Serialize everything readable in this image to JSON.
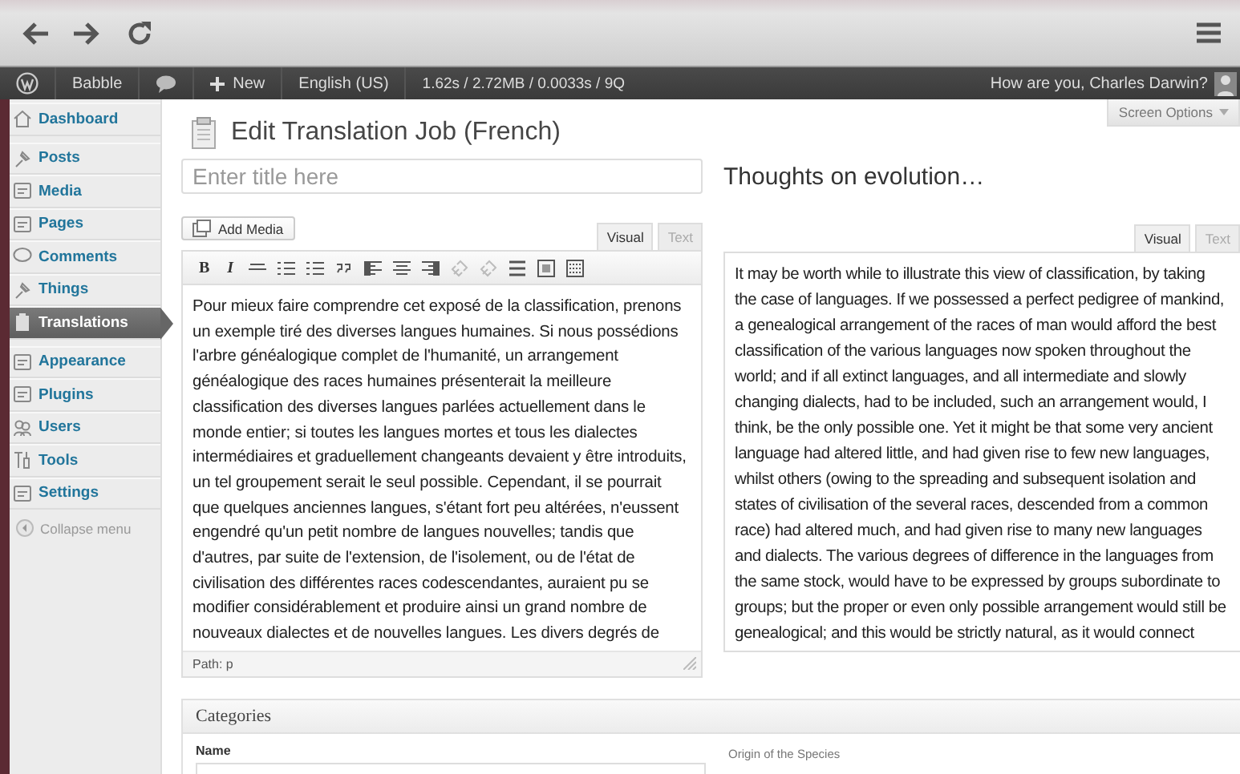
{
  "admin_bar": {
    "site": "Babble",
    "new": "New",
    "language": "English (US)",
    "stats": "1.62s / 2.72MB / 0.0033s / 9Q",
    "greeting": "How are you, Charles Darwin?"
  },
  "sidebar": {
    "items": [
      {
        "label": "Dashboard",
        "selected": false
      },
      {
        "label": "Posts",
        "selected": false
      },
      {
        "label": "Media",
        "selected": false
      },
      {
        "label": "Pages",
        "selected": false
      },
      {
        "label": "Comments",
        "selected": false
      },
      {
        "label": "Things",
        "selected": false
      },
      {
        "label": "Translations",
        "selected": true
      },
      {
        "label": "Appearance",
        "selected": false
      },
      {
        "label": "Plugins",
        "selected": false
      },
      {
        "label": "Users",
        "selected": false
      },
      {
        "label": "Tools",
        "selected": false
      },
      {
        "label": "Settings",
        "selected": false
      }
    ],
    "collapse": "Collapse menu"
  },
  "screen_options": "Screen Options",
  "page_title": "Edit Translation Job (French)",
  "title_field": {
    "placeholder": "Enter title here"
  },
  "original_title": "Thoughts on evolution…",
  "add_media": "Add Media",
  "translation_editor": {
    "tabs": [
      {
        "label": "Visual",
        "selected": true
      },
      {
        "label": "Text",
        "selected": false
      }
    ],
    "toolbar": [
      {
        "kind": "text",
        "label": "B",
        "disabled": false
      },
      {
        "kind": "text",
        "label": "I",
        "disabled": false
      },
      {
        "kind": "strike",
        "disabled": false
      },
      {
        "kind": "bullets",
        "disabled": false
      },
      {
        "kind": "numbers",
        "disabled": false
      },
      {
        "kind": "quote",
        "disabled": false
      },
      {
        "kind": "align-left",
        "disabled": false
      },
      {
        "kind": "align-center",
        "disabled": false
      },
      {
        "kind": "align-right",
        "disabled": false
      },
      {
        "kind": "link",
        "disabled": true
      },
      {
        "kind": "unlink",
        "disabled": true
      },
      {
        "kind": "more",
        "disabled": false
      },
      {
        "kind": "fullscreen",
        "disabled": false
      },
      {
        "kind": "kitchen",
        "disabled": false
      }
    ],
    "content": "Pour mieux faire comprendre cet exposé de la classification, prenons un exemple tiré des diverses langues humaines. Si nous possédions l'arbre généalogique complet de l'humanité, un arrangement généalogique des races humaines présenterait la meilleure classification des diverses langues parlées actuellement dans le monde entier; si toutes les langues mortes et tous les dialectes intermédiaires et graduellement changeants devaient y être introduits, un tel groupement serait le seul possible. Cependant, il se pourrait que quelques anciennes langues, s'étant fort peu altérées, n'eussent engendré qu'un petit nombre de langues nouvelles; tandis que d'autres, par suite de l'extension, de l'isolement, ou de l'état de civilisation des différentes races codescendantes, auraient pu se modifier considérablement et produire ainsi un grand nombre de nouveaux dialectes et de nouvelles langues. Les divers degrés de",
    "path": "Path: p"
  },
  "original_editor": {
    "tabs": [
      {
        "label": "Visual",
        "selected": true
      },
      {
        "label": "Text",
        "selected": false
      }
    ],
    "content": "It may be worth while to illustrate this view of classification, by taking the case of languages. If we possessed a perfect pedigree of mankind, a genealogical arrangement of the races of man would afford the best classification of the various languages now spoken throughout the world; and if all extinct languages, and all intermediate and slowly changing dialects, had to be included, such an arrangement would, I think, be the only possible one. Yet it might be that some very ancient language had altered little, and had given rise to few new languages, whilst others (owing to the spreading and subsequent isolation and states of civilisation of the several races, descended from a common race) had altered much, and had given rise to many new languages and dialects. The various degrees of difference in the languages from the same stock, would have to be expressed by groups subordinate to groups; but the proper or even only possible arrangement would still be genealogical; and this would be strictly natural, as it would connect"
  },
  "categories": {
    "title": "Categories",
    "name_label": "Name",
    "original_value": "Origin of the Species"
  }
}
